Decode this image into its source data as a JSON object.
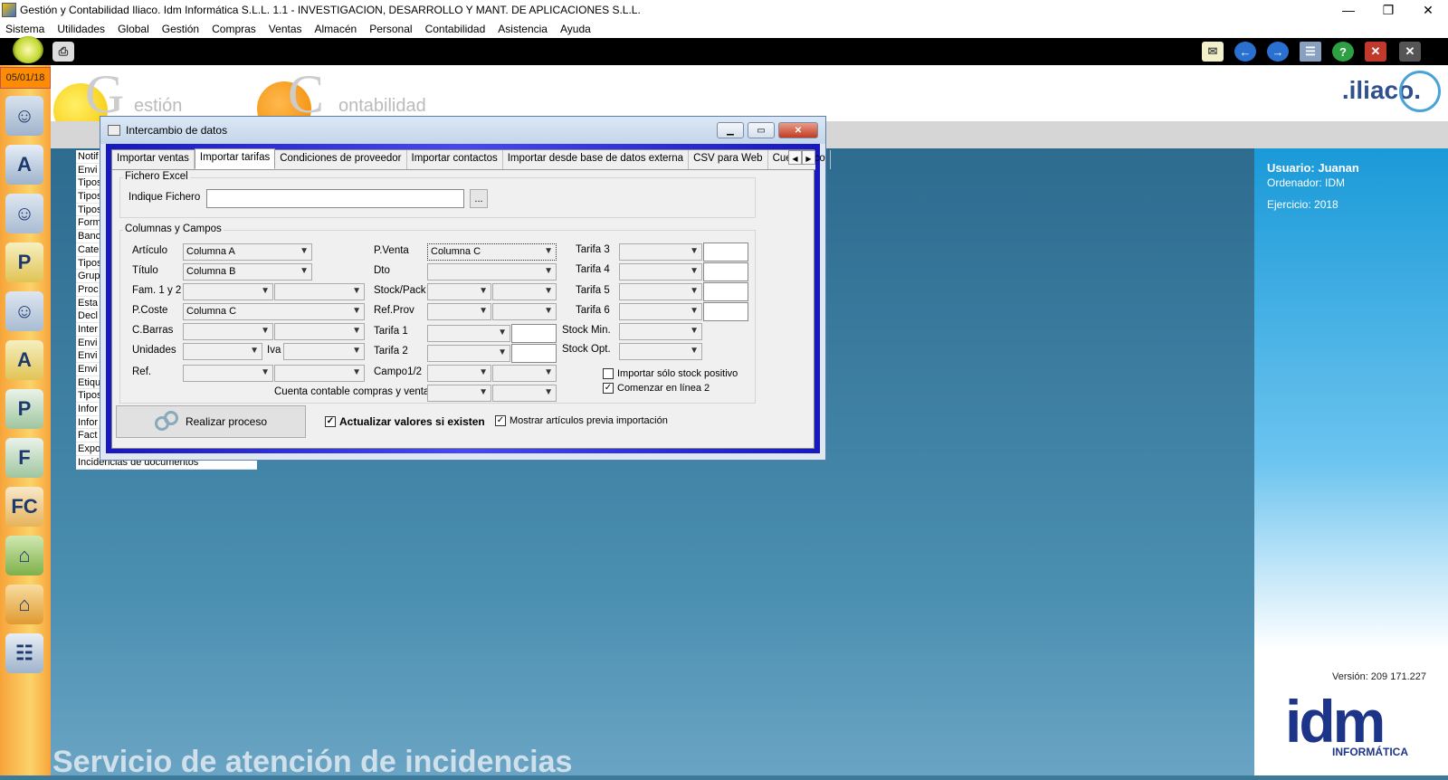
{
  "window": {
    "title": "Gestión y Contabilidad Iliaco. Idm Informática S.L.L. 1.1 - INVESTIGACION, DESARROLLO Y MANT. DE APLICACIONES S.L.L.",
    "minimize": "—",
    "restore": "❐",
    "close": "✕"
  },
  "menu": [
    "Sistema",
    "Utilidades",
    "Global",
    "Gestión",
    "Compras",
    "Ventas",
    "Almacén",
    "Personal",
    "Contabilidad",
    "Asistencia",
    "Ayuda"
  ],
  "toolbar": {
    "icons": [
      "mail-icon",
      "back-icon",
      "forward-icon",
      "window-icon",
      "help-icon",
      "close-icon",
      "exit-icon"
    ]
  },
  "leftbar": {
    "date": "05/01/18",
    "icons": [
      "users-icon",
      "articles-icon",
      "person-icon",
      "person-p-icon",
      "people-icon",
      "person-a-icon",
      "p-doc-icon",
      "f-doc-icon",
      "fc-doc-icon",
      "bag-green-icon",
      "bag-orange-icon",
      "notebook-icon"
    ]
  },
  "header": {
    "gestion_letter": "G",
    "gestion_text": "estión",
    "contab_letter": "C",
    "contab_text": "ontabilidad",
    "logo": ".iliaco."
  },
  "list": {
    "items": [
      "Notif",
      "Envi",
      "Tipos",
      "Tipos",
      "Tipos",
      "Form",
      "Banc",
      "Cate",
      "Tipos",
      "Grup",
      "Proc",
      "Esta",
      "Decl",
      "Inter",
      "Envi",
      "Envi",
      "Envi",
      "Etiqu",
      "Tipos",
      "Infor",
      "Infor",
      "Fact",
      "Expo",
      "Incidencias de documentos"
    ]
  },
  "footer": "Servicio de atención de incidencias",
  "user": {
    "usuario": "Usuario: Juanan",
    "ordenador": "Ordenador: IDM",
    "ejercicio": "Ejercicio: 2018",
    "version": "Versión: 209 171.227",
    "brand": "idm",
    "brand_sub": "INFORMÁTICA"
  },
  "dialog": {
    "title": "Intercambio de datos",
    "tabs": [
      "Importar ventas",
      "Importar tarifas",
      "Condiciones de proveedor",
      "Importar contactos",
      "Importar desde base de datos externa",
      "CSV para Web",
      "Cuentas co"
    ],
    "active_tab": "Importar tarifas",
    "fichero_group": "Fichero Excel",
    "indique_fichero": "Indique Fichero",
    "fichero_value": "",
    "browse": "...",
    "columnas_group": "Columnas y Campos",
    "fields": {
      "articulo": {
        "label": "Artículo",
        "value": "Columna A"
      },
      "titulo": {
        "label": "Título",
        "value": "Columna B"
      },
      "fam": {
        "label": "Fam. 1 y 2",
        "value": ""
      },
      "pcoste": {
        "label": "P.Coste",
        "value": "Columna C"
      },
      "cbarras": {
        "label": "C.Barras",
        "value": ""
      },
      "unidades": {
        "label": "Unidades",
        "value": ""
      },
      "iva": {
        "label": "Iva",
        "value": ""
      },
      "ref": {
        "label": "Ref.",
        "value": ""
      },
      "pventa": {
        "label": "P.Venta",
        "value": "Columna C"
      },
      "dto": {
        "label": "Dto",
        "value": ""
      },
      "stockpack": {
        "label": "Stock/Pack",
        "value": ""
      },
      "refprov": {
        "label": "Ref.Prov",
        "value": ""
      },
      "tarifa1": {
        "label": "Tarifa 1",
        "value": ""
      },
      "tarifa2": {
        "label": "Tarifa 2",
        "value": ""
      },
      "campo12": {
        "label": "Campo1/2",
        "value": ""
      },
      "cuenta": {
        "label": "Cuenta contable compras y ventas",
        "value": ""
      },
      "tarifa3": {
        "label": "Tarifa 3",
        "value": ""
      },
      "tarifa4": {
        "label": "Tarifa 4",
        "value": ""
      },
      "tarifa5": {
        "label": "Tarifa 5",
        "value": ""
      },
      "tarifa6": {
        "label": "Tarifa 6",
        "value": ""
      },
      "stockmin": {
        "label": "Stock Min.",
        "value": ""
      },
      "stockopt": {
        "label": "Stock Opt.",
        "value": ""
      }
    },
    "chk_stock_positivo": {
      "label": "Importar sólo stock positivo",
      "checked": false
    },
    "chk_linea2": {
      "label": "Comenzar en línea 2",
      "checked": true
    },
    "realizar": "Realizar proceso",
    "chk_actualizar": {
      "label": "Actualizar valores si existen",
      "checked": true
    },
    "chk_mostrar": {
      "label": "Mostrar artículos previa importación",
      "checked": true
    }
  },
  "colors": {
    "accent": "#1d3589",
    "dialog_frame": "#2828d8",
    "leftbar": "#f7a43a"
  }
}
